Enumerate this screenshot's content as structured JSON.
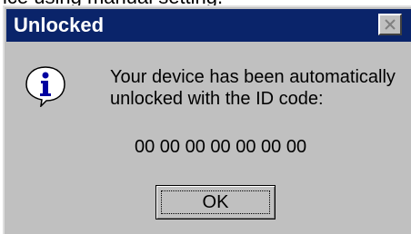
{
  "background_text": "ice using manual setting.",
  "dialog": {
    "title": "Unlocked",
    "message_line1": "Your device has been automatically",
    "message_line2": "unlocked with the ID code:",
    "id_code": "00 00 00 00 00 00 00",
    "ok_label": "OK",
    "icons": {
      "info": "info-icon",
      "close": "close-icon"
    }
  },
  "colors": {
    "titlebar": "#0a246a",
    "dialog_face": "#c0c0c0",
    "info_bubble": "#ffffff",
    "info_letter": "#0000a0"
  }
}
